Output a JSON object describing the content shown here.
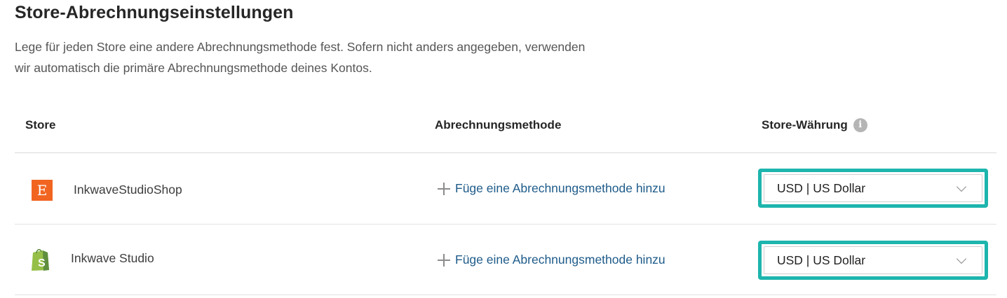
{
  "page": {
    "title": "Store-Abrechnungseinstellungen",
    "description": "Lege für jeden Store eine andere Abrechnungsmethode fest. Sofern nicht anders angegeben, verwenden wir automatisch die primäre Abrechnungsmethode deines Kontos."
  },
  "table": {
    "headers": {
      "store": "Store",
      "method": "Abrechnungsmethode",
      "currency": "Store-Währung"
    },
    "info_icon": "info-icon",
    "rows": [
      {
        "store_icon": "etsy-logo",
        "store_name": "InkwaveStudioShop",
        "add_method_label": "Füge eine Abrechnungsmethode hinzu",
        "currency": "USD | US Dollar"
      },
      {
        "store_icon": "shopify-logo",
        "store_name": "Inkwave Studio",
        "add_method_label": "Füge eine Abrechnungsmethode hinzu",
        "currency": "USD | US Dollar"
      }
    ]
  },
  "colors": {
    "highlight_border": "#1db5ad",
    "link": "#1e5b8a",
    "etsy_orange": "#f16521",
    "shopify_green": "#95bf47"
  }
}
